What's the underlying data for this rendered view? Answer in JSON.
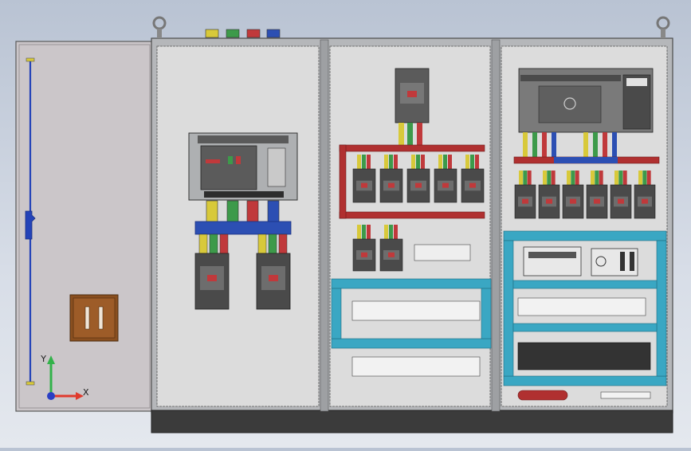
{
  "viewport": {
    "background": [
      "#b9c3d3",
      "#e4e8ee"
    ],
    "colors": {
      "cabinet_frame": "#a8aaad",
      "panel": "#dcdcdc",
      "door": "#cfcacd",
      "busbar_red": "#b03030",
      "busbar_blue": "#2f55c0",
      "phase_yellow": "#d8c93a",
      "phase_green": "#3d9a4a",
      "phase_red": "#c0393b",
      "phase_blue": "#2c4fb3",
      "cable_tray": "#3aa7c3",
      "breaker_body": "#4a4a4a",
      "handle_brown": "#8a4f1f",
      "plinth": "#3b3b3b"
    }
  },
  "triad": {
    "x_label": "X",
    "y_label": "Y",
    "x_color": "#e03a2d",
    "y_color": "#33b24a",
    "z_color": "#2a3fc4"
  },
  "icons": {
    "lifting_eye": "lifting-eye-icon",
    "door_handle": "door-handle-icon",
    "breaker": "circuit-breaker-icon",
    "plc": "plc-module-icon",
    "terminal": "terminal-block-icon"
  }
}
